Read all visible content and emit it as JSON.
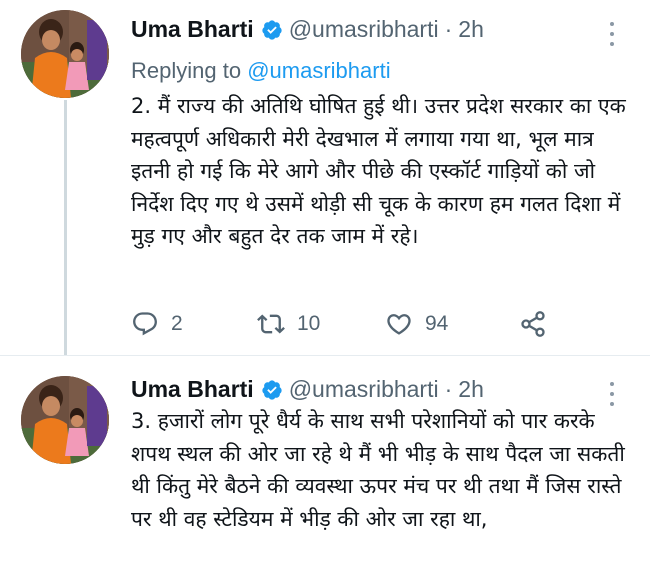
{
  "tweets": [
    {
      "author_name": "Uma Bharti",
      "handle": "@umasribharti",
      "separator": "·",
      "time": "2h",
      "replying_label": "Replying to",
      "replying_to": "@umasribharti",
      "text": "2. मैं राज्य की अतिथि घोषित हुई थी। उत्तर प्रदेश सरकार का एक महत्वपूर्ण अधिकारी मेरी देखभाल में लगाया गया था, भूल मात्र इतनी हो गई कि मेरे आगे और पीछे की एस्कॉर्ट गाड़ियों को जो निर्देश दिए गए थे उसमें थोड़ी सी चूक के कारण हम गलत दिशा में मुड़ गए और बहुत देर तक जाम में रहे।",
      "replies": "2",
      "retweets": "10",
      "likes": "94"
    },
    {
      "author_name": "Uma Bharti",
      "handle": "@umasribharti",
      "separator": "·",
      "time": "2h",
      "text": "3.  हजारों लोग पूरे धैर्य के साथ सभी परेशानियों को पार करके शपथ स्थल की ओर जा रहे थे मैं भी भीड़ के साथ पैदल जा सकती थी किंतु मेरे बैठने की व्यवस्था ऊपर मंच पर थी तथा मैं जिस रास्ते पर थी वह स्टेडियम में भीड़ की ओर जा रहा था,"
    }
  ],
  "colors": {
    "text": "#0f1419",
    "secondary": "#536471",
    "accent": "#1d9bf0"
  },
  "icons": [
    "verified-badge-icon",
    "more-icon",
    "reply-icon",
    "retweet-icon",
    "like-icon",
    "share-icon"
  ]
}
